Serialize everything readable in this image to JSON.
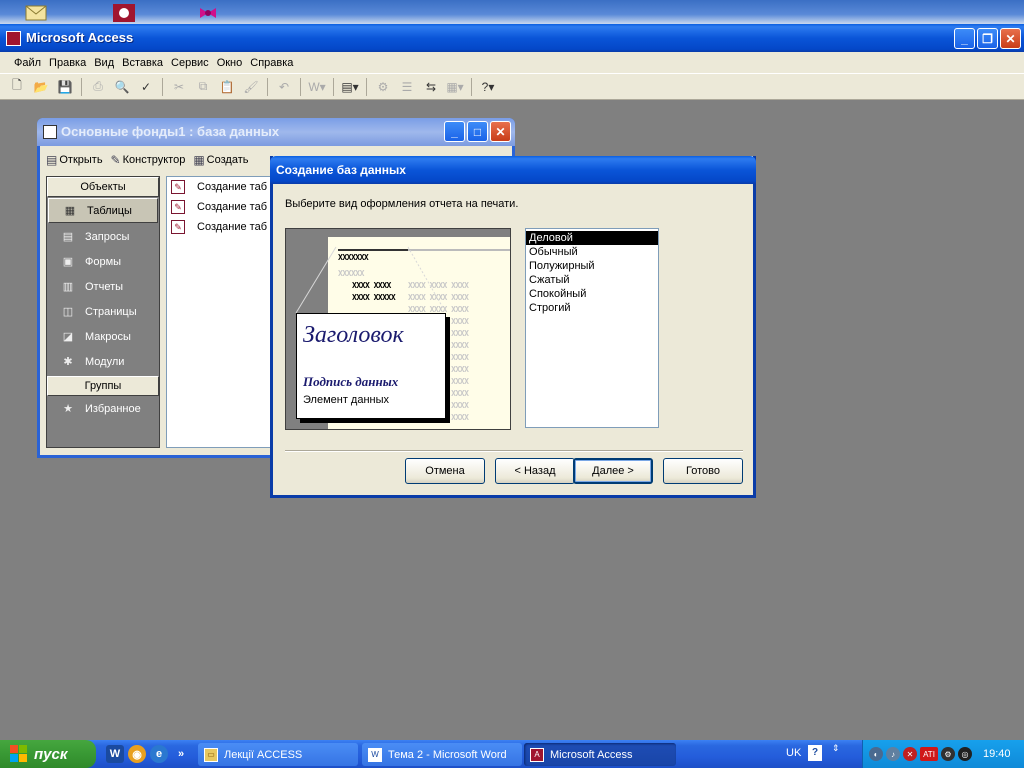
{
  "app": {
    "title": "Microsoft Access",
    "menu": [
      {
        "label": "Файл"
      },
      {
        "label": "Правка"
      },
      {
        "label": "Вид"
      },
      {
        "label": "Вставка"
      },
      {
        "label": "Сервис"
      },
      {
        "label": "Окно"
      },
      {
        "label": "Справка"
      }
    ]
  },
  "db_window": {
    "title": "Основные фонды1 : база данных",
    "toolbar": {
      "open": "Открыть",
      "designer": "Конструктор",
      "create": "Создать"
    },
    "objects_header": "Объекты",
    "objects": [
      {
        "label": "Таблицы",
        "icon": "table-icon"
      },
      {
        "label": "Запросы",
        "icon": "query-icon"
      },
      {
        "label": "Формы",
        "icon": "form-icon"
      },
      {
        "label": "Отчеты",
        "icon": "report-icon"
      },
      {
        "label": "Страницы",
        "icon": "page-icon"
      },
      {
        "label": "Макросы",
        "icon": "macro-icon"
      },
      {
        "label": "Модули",
        "icon": "module-icon"
      }
    ],
    "groups_header": "Группы",
    "groups": [
      {
        "label": "Избранное",
        "icon": "favorites-icon"
      }
    ],
    "list_items": [
      {
        "label": "Создание таб"
      },
      {
        "label": "Создание таб"
      },
      {
        "label": "Создание таб"
      }
    ]
  },
  "wizard": {
    "title": "Создание баз данных",
    "prompt": "Выберите вид оформления отчета на печати.",
    "preview": {
      "heading": "Заголовок",
      "caption": "Подпись данных",
      "element": "Элемент данных",
      "xrow1": "XXXXXXX",
      "xrow2": "XXXXXX",
      "xrow3": "XXXX XXXX",
      "xrow4": "XXXX XXXXX",
      "xlight": "XXXX XXXX XXXX"
    },
    "styles": [
      {
        "label": "Деловой"
      },
      {
        "label": "Обычный"
      },
      {
        "label": "Полужирный"
      },
      {
        "label": "Сжатый"
      },
      {
        "label": "Спокойный"
      },
      {
        "label": "Строгий"
      }
    ],
    "selected_style": "Деловой",
    "buttons": {
      "cancel": "Отмена",
      "back": "< Назад",
      "next": "Далее >",
      "finish": "Готово"
    }
  },
  "taskbar": {
    "start": "пуск",
    "tasks": [
      {
        "label": "Лекції ACCESS",
        "icon": "folder-icon"
      },
      {
        "label": "Тема 2 - Microsoft Word",
        "icon": "word-icon"
      },
      {
        "label": "Microsoft Access",
        "icon": "access-icon"
      }
    ],
    "language": "UK",
    "clock": "19:40"
  }
}
